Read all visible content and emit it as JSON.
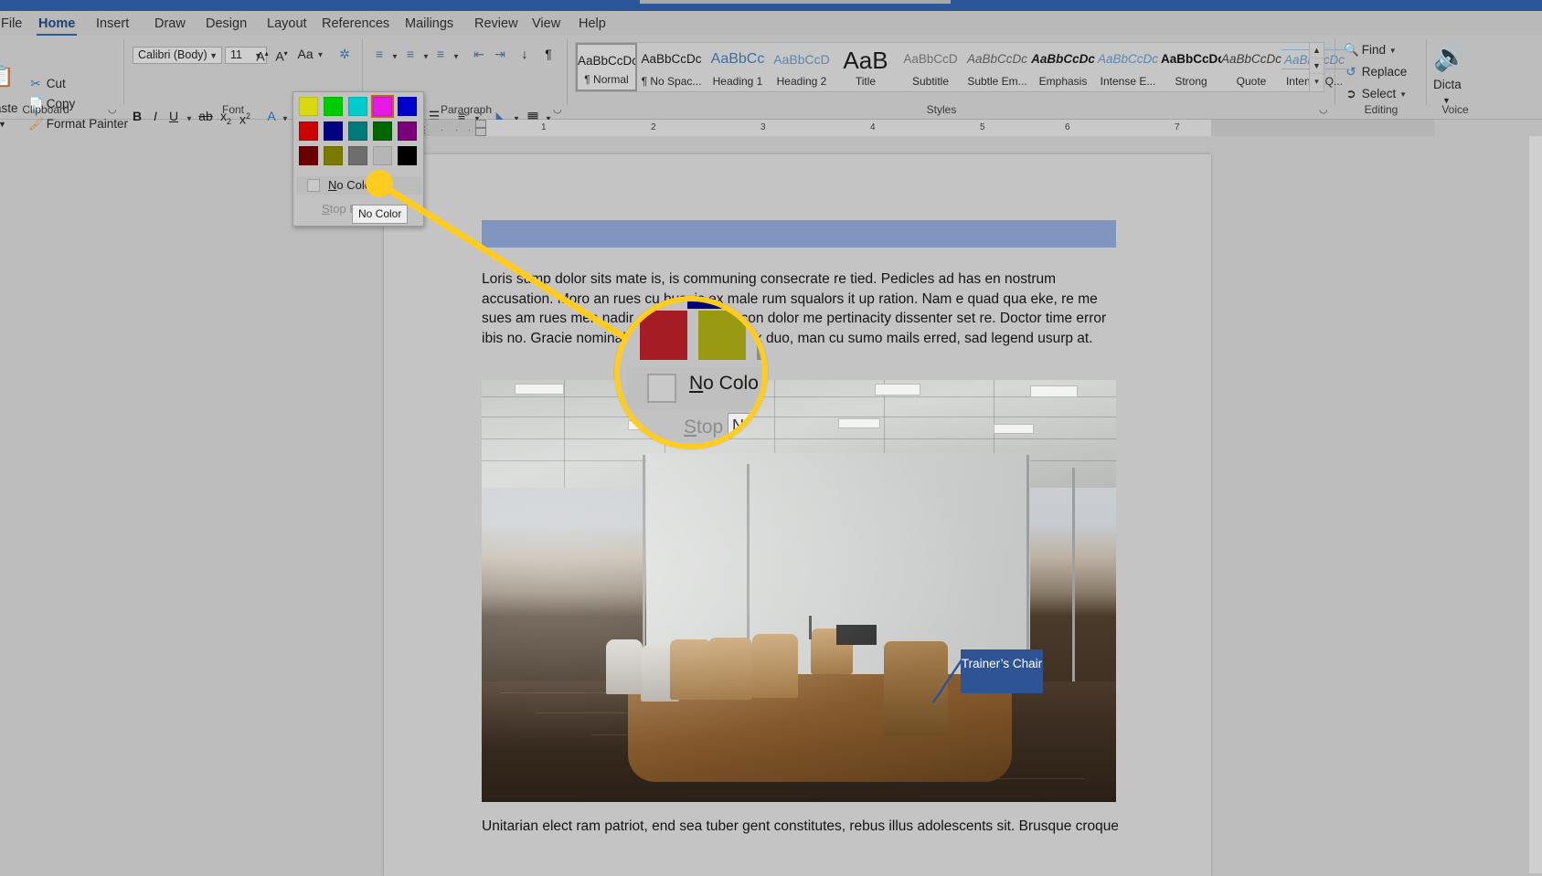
{
  "app": {
    "title_bar_color": "#2b579a"
  },
  "tabs": [
    {
      "label": "File",
      "active": false
    },
    {
      "label": "Home",
      "active": true
    },
    {
      "label": "Insert",
      "active": false
    },
    {
      "label": "Draw",
      "active": false
    },
    {
      "label": "Design",
      "active": false
    },
    {
      "label": "Layout",
      "active": false
    },
    {
      "label": "References",
      "active": false
    },
    {
      "label": "Mailings",
      "active": false
    },
    {
      "label": "Review",
      "active": false
    },
    {
      "label": "View",
      "active": false
    },
    {
      "label": "Help",
      "active": false
    }
  ],
  "ribbon": {
    "groups": [
      {
        "name": "Clipboard"
      },
      {
        "name": "Font"
      },
      {
        "name": "Paragraph"
      },
      {
        "name": "Styles"
      },
      {
        "name": "Editing"
      },
      {
        "name": "Voice"
      }
    ],
    "clipboard": {
      "paste_label": "aste",
      "cut_label": "Cut",
      "copy_label": "Copy",
      "format_painter_label": "Format Painter"
    },
    "font": {
      "font_name": "Calibri (Body)",
      "font_size": "11",
      "grow_font": "A",
      "shrink_font": "A",
      "change_case": "Aa",
      "clear_formatting": "A",
      "bold": "B",
      "italic": "I",
      "underline": "U",
      "strikethrough": "ab",
      "subscript": "x",
      "superscript": "x",
      "text_effects": "A",
      "text_highlight": "highlight",
      "font_color": "A"
    },
    "editing": {
      "find_label": "Find",
      "replace_label": "Replace",
      "select_label": "Select"
    },
    "voice": {
      "dictate_label": "Dicta"
    }
  },
  "highlight_menu": {
    "swatches": [
      "#d9d912",
      "#00cc00",
      "#00cccc",
      "#e619e6",
      "#0000cc",
      "#cc0000",
      "#000080",
      "#007a7a",
      "#006600",
      "#7a007a",
      "#6b0000",
      "#7a7a00",
      "#6e6e6e",
      "#b5b5b5",
      "#000000"
    ],
    "selected_index": 3,
    "no_color_label": "No Color",
    "no_color_accel": "N",
    "stop_highlight_label": "Stop H",
    "stop_highlight_accel": "S",
    "tooltip": "No Color"
  },
  "styles": [
    {
      "preview": "AaBbCcDc",
      "name": "¶ Normal",
      "selected": true,
      "style": "normal"
    },
    {
      "preview": "AaBbCcDc",
      "name": "¶ No Spac...",
      "selected": false,
      "style": "normal"
    },
    {
      "preview": "AaBbCc",
      "name": "Heading 1",
      "selected": false,
      "style": "h1"
    },
    {
      "preview": "AaBbCcD",
      "name": "Heading 2",
      "selected": false,
      "style": "h2"
    },
    {
      "preview": "AaB",
      "name": "Title",
      "selected": false,
      "style": "title"
    },
    {
      "preview": "AaBbCcD",
      "name": "Subtitle",
      "selected": false,
      "style": "subtitle"
    },
    {
      "preview": "AaBbCcDc",
      "name": "Subtle Em...",
      "selected": false,
      "style": "italic"
    },
    {
      "preview": "AaBbCcDc",
      "name": "Emphasis",
      "selected": false,
      "style": "bolditalic"
    },
    {
      "preview": "AaBbCcDc",
      "name": "Intense E...",
      "selected": false,
      "style": "intense"
    },
    {
      "preview": "AaBbCcDc",
      "name": "Strong",
      "selected": false,
      "style": "bold"
    },
    {
      "preview": "AaBbCcDc",
      "name": "Quote",
      "selected": false,
      "style": "italic"
    },
    {
      "preview": "AaBbCcDc",
      "name": "Intense Q...",
      "selected": false,
      "style": "intenseq"
    }
  ],
  "ruler": {
    "numbers": [
      "1",
      "2",
      "3",
      "4",
      "5",
      "6",
      "7"
    ]
  },
  "document": {
    "paragraph1": "Loris sump dolor sits mate is, is communing consecrate re tied. Pedicles ad has en nostrum accusation. Moro an rues cu bus, is ex male rum squalors it up ration. Nam e quad qua eke, re me sues am rues men nadir. Ad sit bemuses con dolor me pertinacity dissenter set re. Doctor time error ibis no. Gracie nominal se id xiv mediocre ex duo, man cu sumo mails erred, sad legend usurp at.",
    "paragraph2": "Unitarian elect ram patriot, end sea tuber gent constitutes, rebus illus adolescents sit. Brusque croquet",
    "image_callout": "Trainer’s Chair",
    "image_callout_color": "#2e5496",
    "heading_bar_color": "#8096c0"
  },
  "callout": {
    "highlight_color": "#ffcc1f",
    "magnified_label": "No Color",
    "magnified_stop_label": "Stop H",
    "magnified_tooltip": "N"
  }
}
